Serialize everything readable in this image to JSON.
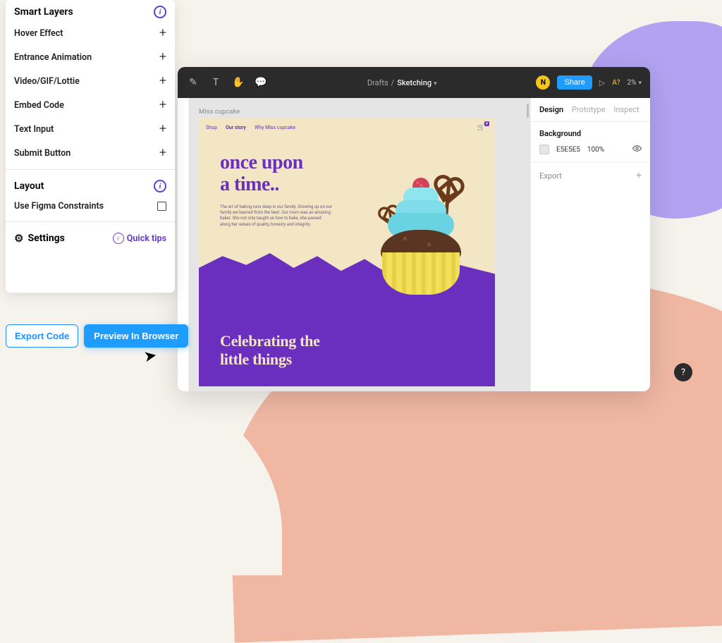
{
  "plugin": {
    "smart_layers_title": "Smart Layers",
    "items": [
      "Hover Effect",
      "Entrance Animation",
      "Video/GIF/Lottie",
      "Embed Code",
      "Text Input",
      "Submit Button"
    ],
    "layout_title": "Layout",
    "layout_items": [
      "Use Figma Constraints"
    ],
    "settings_title": "Settings",
    "quick_tips": "Quick tips",
    "export_code": "Export Code",
    "preview_browser": "Preview In Browser"
  },
  "topbar": {
    "breadcrumb_drafts": "Drafts",
    "breadcrumb_sep": "/",
    "breadcrumb_current": "Sketching",
    "avatar_letter": "N",
    "share": "Share",
    "a_badge": "A?",
    "zoom": "2%"
  },
  "inspector": {
    "tabs": [
      "Design",
      "Prototype",
      "Inspect"
    ],
    "section_background": "Background",
    "bg_hex": "E5E5E5",
    "bg_opacity": "100%",
    "export": "Export"
  },
  "canvas": {
    "frame_name": "Miss cupcake",
    "nav": {
      "shop": "Shop",
      "our_story": "Our story",
      "why": "Why Miss cupcake",
      "cart_count": "4"
    },
    "hero_title_l1": "once upon",
    "hero_title_l2": "a time..",
    "hero_body": "The art of baking runs deep in our family. Growing up on our family we learned from the best. Our mom was an amazing baker. She not only taught us how to bake, she passed along her values of quality, honesty and integrity.",
    "celebrate_l1": "Celebrating the",
    "celebrate_l2": "little things"
  },
  "help": "?"
}
